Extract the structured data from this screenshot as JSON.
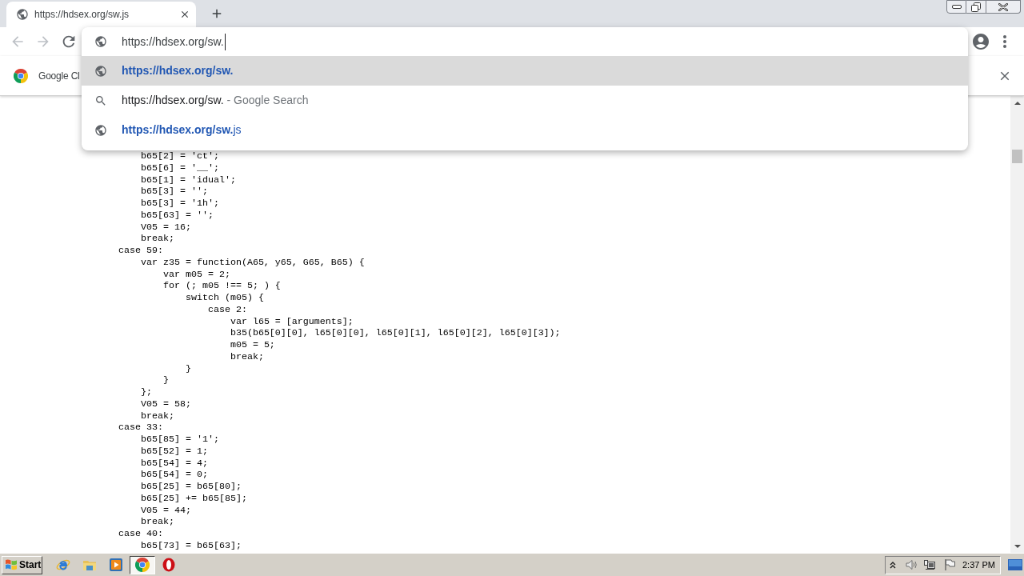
{
  "tabs": [
    {
      "title": "https://hdsex.org/sw.js",
      "selected": true
    }
  ],
  "omnibox": {
    "value": "https://hdsex.org/sw."
  },
  "suggestions": [
    {
      "kind": "url",
      "match": "https://hdsex.org/sw.",
      "selected": true
    },
    {
      "kind": "search",
      "match": "https://hdsex.org/sw.",
      "suffix": "- Google Search",
      "selected": false
    },
    {
      "kind": "url",
      "match": "https://hdsex.org/sw.",
      "completion": "js",
      "selected": false
    }
  ],
  "infobar": {
    "text": "Google Cl"
  },
  "code": {
    "lines": [
      "    b65[2] = 'ct';",
      "    b65[6] = '__';",
      "    b65[1] = 'idual';",
      "    b65[3] = '';",
      "    b65[3] = '1h';",
      "    b65[63] = '';",
      "    V05 = 16;",
      "    break;",
      "case 59:",
      "    var z35 = function(A65, y65, G65, B65) {",
      "        var m05 = 2;",
      "        for (; m05 !== 5; ) {",
      "            switch (m05) {",
      "                case 2:",
      "                    var l65 = [arguments];",
      "                    b35(b65[0][0], l65[0][0], l65[0][1], l65[0][2], l65[0][3]);",
      "                    m05 = 5;",
      "                    break;",
      "            }",
      "        }",
      "    };",
      "    V05 = 58;",
      "    break;",
      "case 33:",
      "    b65[85] = '1';",
      "    b65[52] = 1;",
      "    b65[54] = 4;",
      "    b65[54] = 0;",
      "    b65[25] = b65[80];",
      "    b65[25] += b65[85];",
      "    V05 = 44;",
      "    break;",
      "case 40:",
      "    b65[73] = b65[63];"
    ]
  },
  "taskbar": {
    "start": "Start",
    "apps": [
      {
        "selected": false
      },
      {
        "selected": false
      },
      {
        "selected": false
      },
      {
        "selected": true
      },
      {
        "selected": false
      }
    ],
    "clock": "2:37 PM"
  }
}
